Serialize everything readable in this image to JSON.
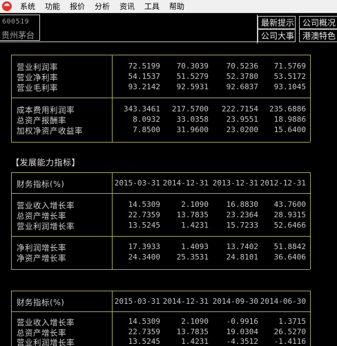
{
  "menu": [
    "系统",
    "功能",
    "报价",
    "分析",
    "资讯",
    "工具",
    "帮助"
  ],
  "stock": {
    "code": "600519",
    "name": "贵州茅台"
  },
  "nav": {
    "latest_tips": "最新提示",
    "company_profile": "公司概况",
    "company_events": "公司大事",
    "port_features": "港澳特色"
  },
  "table1": {
    "group1": [
      {
        "label": "营业利润率",
        "values": [
          "72.5199",
          "70.3039",
          "70.5236",
          "71.5769"
        ]
      },
      {
        "label": "营业净利率",
        "values": [
          "54.1537",
          "51.5279",
          "52.3780",
          "53.5172"
        ]
      },
      {
        "label": "营业毛利率",
        "values": [
          "93.2142",
          "92.5931",
          "92.6837",
          "93.1045"
        ]
      }
    ],
    "group2": [
      {
        "label": "成本费用利润率",
        "values": [
          "343.3461",
          "217.5700",
          "222.7154",
          "235.6886"
        ]
      },
      {
        "label": "总资产报酬率",
        "values": [
          "8.0932",
          "33.0358",
          "23.9551",
          "18.9886"
        ]
      },
      {
        "label": "加权净资产收益率",
        "values": [
          "7.8500",
          "31.9600",
          "23.0200",
          "15.6400"
        ]
      }
    ]
  },
  "section2_title": "【发展能力指标】",
  "table2": {
    "header_label": "财务指标(%)",
    "dates": [
      "2015-03-31",
      "2014-12-31",
      "2013-12-31",
      "2012-12-31"
    ],
    "group1": [
      {
        "label": "营业收入增长率",
        "values": [
          "14.5309",
          "2.1090",
          "16.8830",
          "43.7600"
        ]
      },
      {
        "label": "总资产增长率",
        "values": [
          "22.7359",
          "13.7835",
          "23.2364",
          "28.9315"
        ]
      },
      {
        "label": "营业利润增长率",
        "values": [
          "13.5245",
          "1.4231",
          "15.7233",
          "52.6466"
        ]
      }
    ],
    "group2": [
      {
        "label": "净利润增长率",
        "values": [
          "17.3933",
          "1.4093",
          "13.7402",
          "51.8842"
        ]
      },
      {
        "label": "净资产增长率",
        "values": [
          "24.3400",
          "25.3531",
          "24.8101",
          "36.6406"
        ]
      }
    ]
  },
  "table3": {
    "header_label": "财务指标(%)",
    "dates": [
      "2015-03-31",
      "2014-12-31",
      "2014-09-30",
      "2014-06-30"
    ],
    "rows": [
      {
        "label": "营业收入增长率",
        "values": [
          "14.5309",
          "2.1090",
          "-0.9916",
          "1.3715"
        ]
      },
      {
        "label": "总资产增长率",
        "values": [
          "22.7359",
          "13.7835",
          "19.0304",
          "26.5270"
        ]
      },
      {
        "label": "营业利润增长率",
        "values": [
          "13.5245",
          "1.4231",
          "-4.3512",
          "-1.4116"
        ]
      }
    ]
  }
}
